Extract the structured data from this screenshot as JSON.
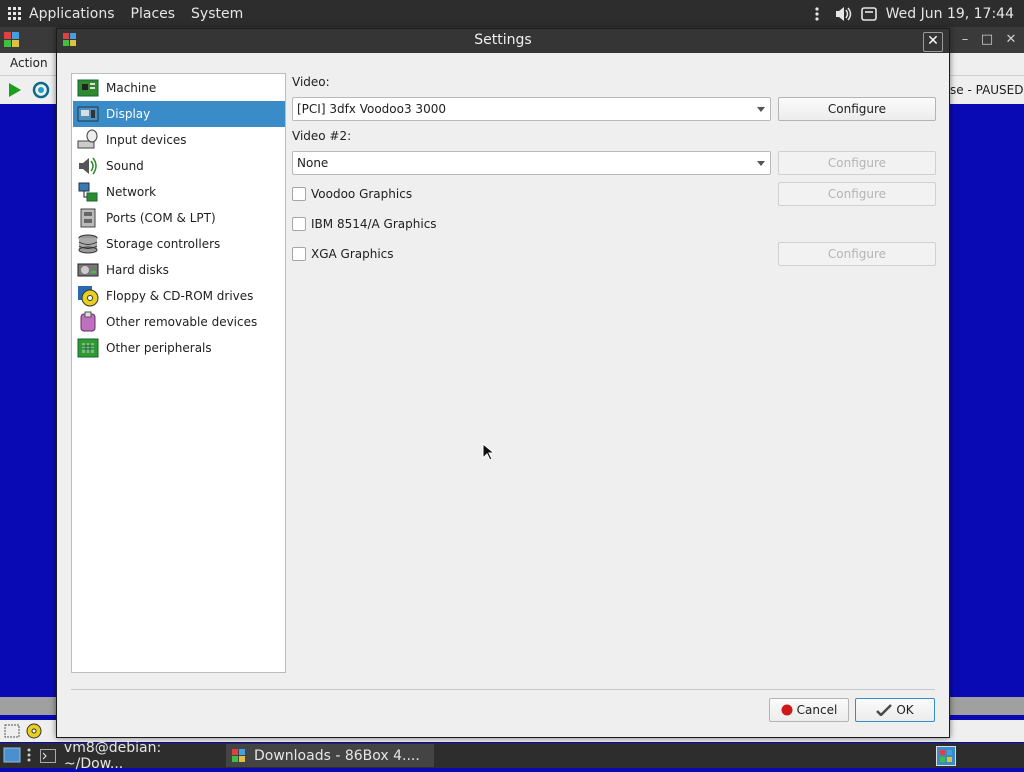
{
  "top_panel": {
    "applications": "Applications",
    "places": "Places",
    "system": "System",
    "clock": "Wed Jun 19, 17:44"
  },
  "main_window": {
    "menu_action": "Action",
    "status_text": "se - PAUSED"
  },
  "dialog": {
    "title": "Settings",
    "categories": [
      {
        "label": "Machine",
        "icon": "machine-icon"
      },
      {
        "label": "Display",
        "icon": "display-icon"
      },
      {
        "label": "Input devices",
        "icon": "input-devices-icon"
      },
      {
        "label": "Sound",
        "icon": "sound-icon"
      },
      {
        "label": "Network",
        "icon": "network-icon"
      },
      {
        "label": "Ports (COM & LPT)",
        "icon": "ports-icon"
      },
      {
        "label": "Storage controllers",
        "icon": "storage-controllers-icon"
      },
      {
        "label": "Hard disks",
        "icon": "hard-disk-icon"
      },
      {
        "label": "Floppy & CD-ROM drives",
        "icon": "floppy-cdrom-icon"
      },
      {
        "label": "Other removable devices",
        "icon": "removable-devices-icon"
      },
      {
        "label": "Other peripherals",
        "icon": "peripherals-icon"
      }
    ],
    "selected_category": "Display",
    "display": {
      "video_label": "Video:",
      "video_value": "[PCI] 3dfx Voodoo3 3000",
      "video2_label": "Video #2:",
      "video2_value": "None",
      "configure_label": "Configure",
      "voodoo_label": "Voodoo Graphics",
      "ibm_label": "IBM 8514/A Graphics",
      "xga_label": "XGA Graphics"
    },
    "cancel_label": "Cancel",
    "ok_label": "OK"
  },
  "taskbar": {
    "tasks": [
      {
        "label": "vm8@debian: ~/Dow..."
      },
      {
        "label": "Downloads - 86Box 4...."
      }
    ]
  },
  "colors": {
    "selection": "#3a8cc8",
    "vm_background": "#0a0ab4",
    "panel": "#2d2d2d"
  }
}
